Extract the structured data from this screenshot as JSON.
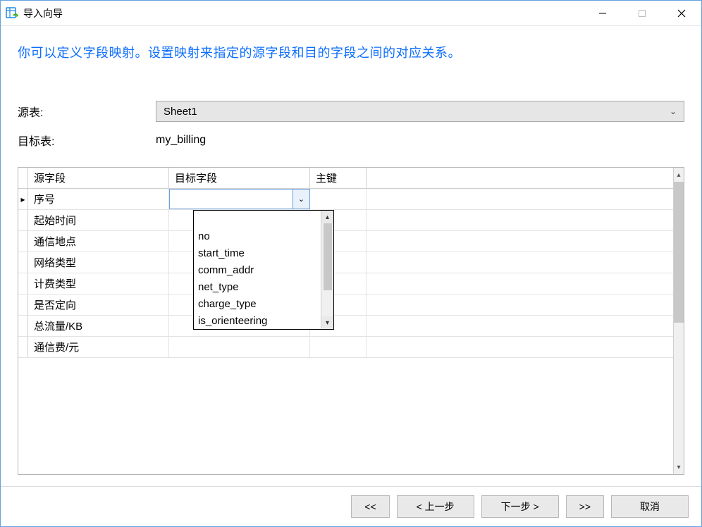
{
  "window": {
    "title": "导入向导"
  },
  "heading": "你可以定义字段映射。设置映射来指定的源字段和目的字段之间的对应关系。",
  "labels": {
    "source_table": "源表:",
    "target_table": "目标表:"
  },
  "values": {
    "source_table": "Sheet1",
    "target_table": "my_billing"
  },
  "columns": {
    "source": "源字段",
    "target": "目标字段",
    "pk": "主键"
  },
  "rows": [
    {
      "src": "序号"
    },
    {
      "src": "起始时间"
    },
    {
      "src": "通信地点"
    },
    {
      "src": "网络类型"
    },
    {
      "src": "计费类型"
    },
    {
      "src": "是否定向"
    },
    {
      "src": "总流量/KB"
    },
    {
      "src": "通信费/元"
    }
  ],
  "dropdown_options": [
    "no",
    "start_time",
    "comm_addr",
    "net_type",
    "charge_type",
    "is_orienteering"
  ],
  "buttons": {
    "first": "<<",
    "prev": "< 上一步",
    "next": "下一步 >",
    "last": ">>",
    "cancel": "取消"
  }
}
